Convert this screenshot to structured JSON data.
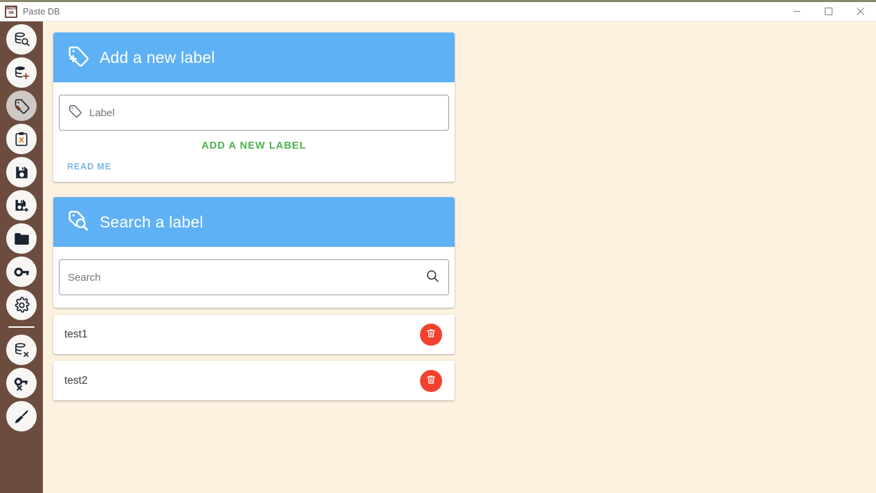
{
  "window": {
    "title": "Paste DB",
    "icon_name": "app-icon",
    "icon_text": "PASTE DB",
    "controls": {
      "minimize": "–",
      "maximize": "□",
      "close": "✕"
    }
  },
  "colors": {
    "sidebar": "#6d4c40",
    "background": "#fdf2e0",
    "header_blue": "#5fb1f5",
    "accent_green": "#4caf50",
    "link_blue": "#7bb8e8",
    "delete_red": "#f4402e",
    "card_white": "#ffffff"
  },
  "sidebar": {
    "items": [
      {
        "name": "sidebar-item-search-database",
        "icon": "database-search-icon",
        "active": false
      },
      {
        "name": "sidebar-item-add-database",
        "icon": "database-plus-icon",
        "active": false
      },
      {
        "name": "sidebar-item-add-label",
        "icon": "tag-plus-icon",
        "active": true
      },
      {
        "name": "sidebar-item-clipboard-clear",
        "icon": "clipboard-x-icon",
        "active": false
      },
      {
        "name": "sidebar-item-save",
        "icon": "floppy-save-icon",
        "active": false
      },
      {
        "name": "sidebar-item-save-as",
        "icon": "floppy-export-icon",
        "active": false
      },
      {
        "name": "sidebar-item-open",
        "icon": "folder-icon",
        "active": false
      },
      {
        "name": "sidebar-item-key",
        "icon": "key-icon",
        "active": false
      },
      {
        "name": "sidebar-item-settings",
        "icon": "gear-icon",
        "active": false
      },
      {
        "name": "sidebar-item-delete-database",
        "icon": "database-x-icon",
        "active": false
      },
      {
        "name": "sidebar-item-delete-key",
        "icon": "key-x-icon",
        "active": false
      },
      {
        "name": "sidebar-item-clean",
        "icon": "broom-icon",
        "active": false
      }
    ]
  },
  "add_label_card": {
    "header_title": "Add a new label",
    "header_icon": "tag-plus-icon",
    "input": {
      "placeholder": "Label",
      "value": "",
      "icon": "tag-icon"
    },
    "submit_label": "ADD A NEW LABEL",
    "readme_link": "READ ME"
  },
  "search_card": {
    "header_title": "Search a label",
    "header_icon": "tag-search-icon",
    "input": {
      "placeholder": "Search",
      "value": "",
      "icon": "search-icon"
    }
  },
  "results": {
    "rows": [
      {
        "name": "test1",
        "delete_icon": "trash-icon"
      },
      {
        "name": "test2",
        "delete_icon": "trash-icon"
      }
    ]
  }
}
